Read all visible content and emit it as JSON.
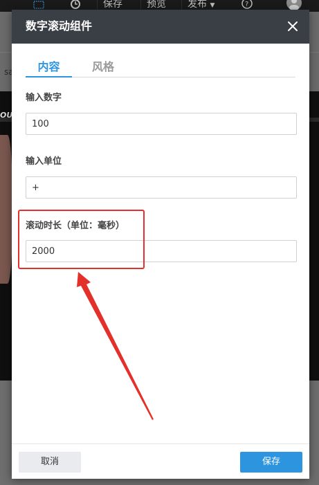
{
  "topbar": {
    "items": [
      "保存",
      "预览",
      "发布"
    ],
    "icons": [
      "grid-icon",
      "history-icon",
      "help-icon",
      "avatar"
    ]
  },
  "background": {
    "label_fragment": "sa",
    "image_text_fragment": "OU"
  },
  "modal": {
    "title": "数字滚动组件",
    "tabs": [
      {
        "label": "内容",
        "active": true
      },
      {
        "label": "风格",
        "active": false
      }
    ],
    "fields": [
      {
        "label": "输入数字",
        "value": "100"
      },
      {
        "label": "输入单位",
        "value": "+"
      },
      {
        "label": "滚动时长（单位：毫秒）",
        "value": "2000"
      }
    ],
    "buttons": {
      "cancel": "取消",
      "save": "保存"
    }
  },
  "colors": {
    "accent": "#2d95e0",
    "header_bg": "#3a3e45",
    "annotation_red": "#e4302a"
  }
}
